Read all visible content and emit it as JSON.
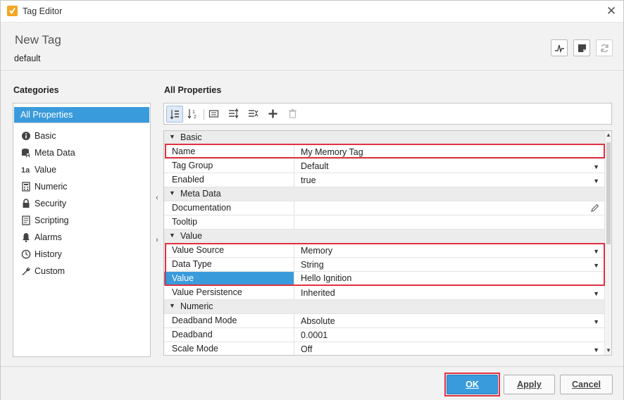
{
  "window": {
    "title": "Tag Editor"
  },
  "header": {
    "tag_name": "New Tag",
    "provider": "default"
  },
  "categories": {
    "heading": "Categories",
    "items": [
      {
        "label": "All Properties",
        "icon": "none"
      },
      {
        "label": "Basic",
        "icon": "info-icon"
      },
      {
        "label": "Meta Data",
        "icon": "metadata-icon"
      },
      {
        "label": "Value",
        "icon": "value-icon"
      },
      {
        "label": "Numeric",
        "icon": "numeric-icon"
      },
      {
        "label": "Security",
        "icon": "lock-icon"
      },
      {
        "label": "Scripting",
        "icon": "script-icon"
      },
      {
        "label": "Alarms",
        "icon": "bell-icon"
      },
      {
        "label": "History",
        "icon": "clock-icon"
      },
      {
        "label": "Custom",
        "icon": "wrench-icon"
      }
    ]
  },
  "properties": {
    "heading": "All Properties",
    "rows": [
      {
        "type": "section",
        "label": "Basic"
      },
      {
        "type": "prop",
        "name": "Name",
        "value": "My Memory Tag"
      },
      {
        "type": "prop",
        "name": "Tag Group",
        "value": "Default",
        "dropdown": true
      },
      {
        "type": "prop",
        "name": "Enabled",
        "value": "true",
        "dropdown": true
      },
      {
        "type": "section",
        "label": "Meta Data"
      },
      {
        "type": "prop",
        "name": "Documentation",
        "value": "",
        "editor": true
      },
      {
        "type": "prop",
        "name": "Tooltip",
        "value": ""
      },
      {
        "type": "section",
        "label": "Value"
      },
      {
        "type": "prop",
        "name": "Value Source",
        "value": "Memory",
        "dropdown": true
      },
      {
        "type": "prop",
        "name": "Data Type",
        "value": "String",
        "dropdown": true
      },
      {
        "type": "prop",
        "name": "Value",
        "value": "Hello Ignition",
        "selected": true
      },
      {
        "type": "prop",
        "name": "Value Persistence",
        "value": "Inherited",
        "dropdown": true
      },
      {
        "type": "section",
        "label": "Numeric"
      },
      {
        "type": "prop",
        "name": "Deadband Mode",
        "value": "Absolute",
        "dropdown": true
      },
      {
        "type": "prop",
        "name": "Deadband",
        "value": "0.0001"
      },
      {
        "type": "prop",
        "name": "Scale Mode",
        "value": "Off",
        "dropdown": true
      }
    ]
  },
  "footer": {
    "ok": "OK",
    "apply": "Apply",
    "cancel": "Cancel"
  },
  "colors": {
    "selection": "#3a9bdc",
    "highlight": "#e0323f",
    "app_icon": "#f5a623"
  }
}
